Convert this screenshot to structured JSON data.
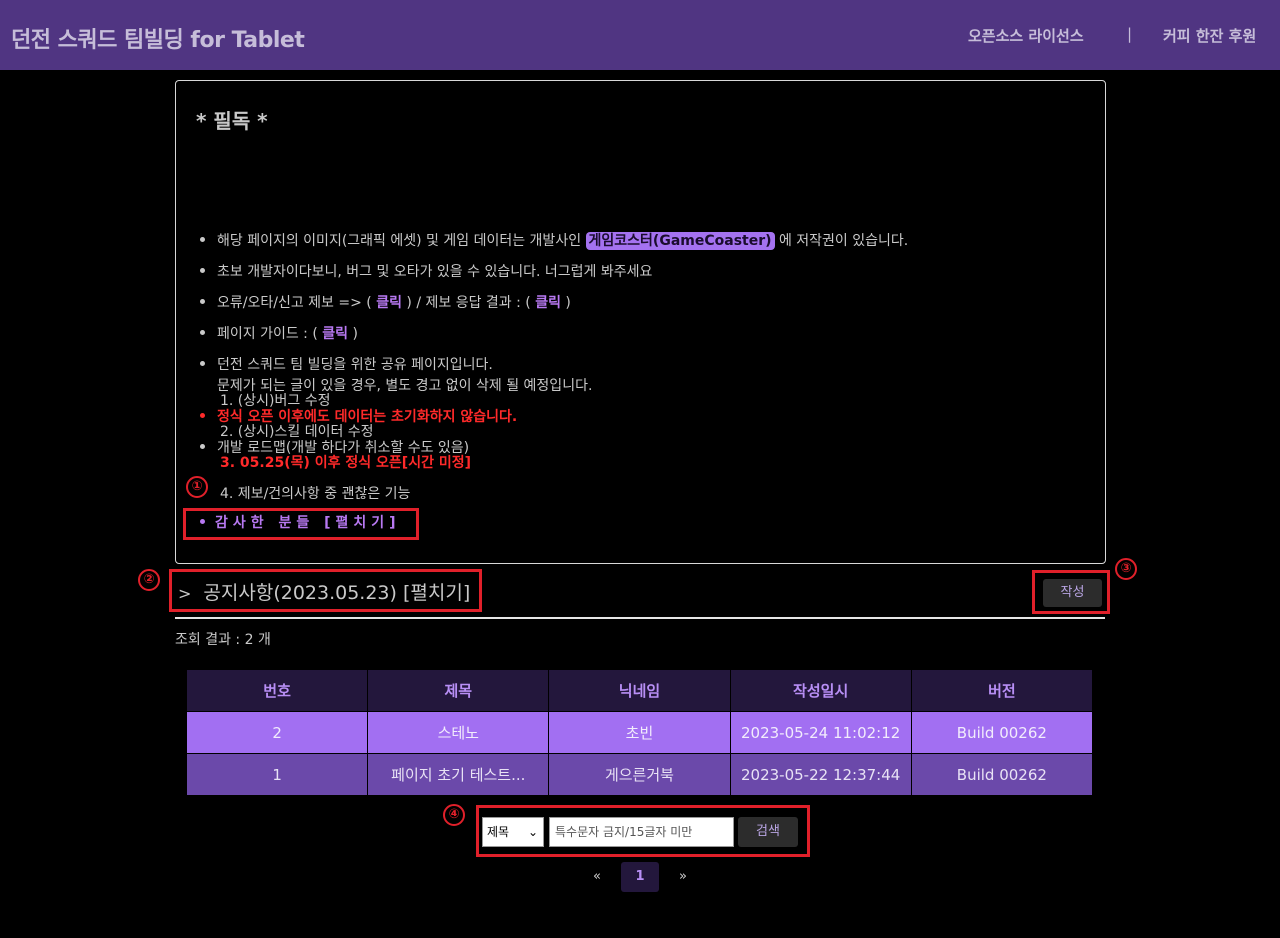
{
  "header": {
    "title": "던전 스쿼드 팀빌딩 for Tablet",
    "links": [
      "오픈소스 라이선스",
      "커피 한잔 후원"
    ],
    "separator": "|"
  },
  "notice": {
    "title": "* 필독 *",
    "item1_pre": "해당 페이지의 이미지(그래픽 에셋) 및 게임 데이터는 개발사인 ",
    "item1_highlight": "게임코스터(GameCoaster)",
    "item1_post": " 에 저작권이 있습니다.",
    "item2": "초보 개발자이다보니, 버그 및 오타가 있을 수 있습니다. 너그럽게 봐주세요",
    "item3_pre": "오류/오타/신고 제보 => ( ",
    "item3_link1": "클릭",
    "item3_mid": " ) / 제보 응답 결과 : ( ",
    "item3_link2": "클릭",
    "item3_post": " )",
    "item4_pre": "페이지 가이드 : ( ",
    "item4_link": "클릭",
    "item4_post": " )",
    "item5_line1": "던전 스쿼드 팀 빌딩을 위한 공유 페이지입니다.",
    "item5_line2": "문제가 되는 글이 있을 경우, 별도 경고 없이 삭제 될 예정입니다.",
    "item6_red": "정식 오픈 이후에도 데이터는 초기화하지 않습니다.",
    "item7": "개발 로드맵(개발 하다가 취소할 수도 있음)",
    "roadmap": [
      "1. (상시)버그 수정",
      "2. (상시)스킬 데이터 수정",
      "3. 05.25(목) 이후 정식 오픈[시간 미정]",
      "4. 제보/건의사항 중 괜찮은 기능"
    ],
    "thanks": "감사한 분들 [펼치기]"
  },
  "annotations": [
    "①",
    "②",
    "③",
    "④"
  ],
  "announcement": {
    "chevron": ">",
    "label": "공지사항(2023.05.23) [펼치기]"
  },
  "write_button": "작성",
  "result_text": "조회 결과 : 2 개",
  "table": {
    "headers": [
      "번호",
      "제목",
      "닉네임",
      "작성일시",
      "버전"
    ],
    "rows": [
      [
        "2",
        "스테노",
        "초빈",
        "2023-05-24 11:02:12",
        "Build 00262"
      ],
      [
        "1",
        "페이지 초기 테스트...",
        "게으른거북",
        "2023-05-22 12:37:44",
        "Build 00262"
      ]
    ]
  },
  "search": {
    "select_value": "제목",
    "placeholder": "특수문자 금지/15글자 미만",
    "button": "검색"
  },
  "pagination": {
    "prev": "«",
    "current": "1",
    "next": "»"
  },
  "colors": {
    "header_bg": "#503582",
    "accent": "#a472f0",
    "annotation": "#e0202a",
    "warning": "#ff2a2a"
  }
}
